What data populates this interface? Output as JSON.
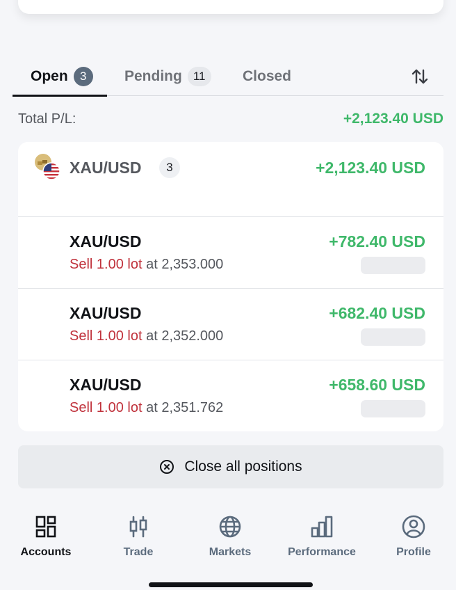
{
  "tabs": [
    {
      "label": "Open",
      "count": "3"
    },
    {
      "label": "Pending",
      "count": "11"
    },
    {
      "label": "Closed"
    }
  ],
  "summary": {
    "label": "Total P/L:",
    "value": "+2,123.40 USD"
  },
  "group": {
    "symbol": "XAU/USD",
    "count": "3",
    "pl": "+2,123.40 USD"
  },
  "positions": [
    {
      "symbol": "XAU/USD",
      "side": "Sell 1.00 lot",
      "at": "at 2,353.000",
      "pl": "+782.40 USD"
    },
    {
      "symbol": "XAU/USD",
      "side": "Sell 1.00 lot",
      "at": "at 2,352.000",
      "pl": "+682.40 USD"
    },
    {
      "symbol": "XAU/USD",
      "side": "Sell 1.00 lot",
      "at": "at 2,351.762",
      "pl": "+658.60 USD"
    }
  ],
  "close_all_label": "Close all positions",
  "nav": [
    {
      "label": "Accounts",
      "icon": "accounts-icon"
    },
    {
      "label": "Trade",
      "icon": "trade-icon"
    },
    {
      "label": "Markets",
      "icon": "globe-icon"
    },
    {
      "label": "Performance",
      "icon": "bar-chart-icon"
    },
    {
      "label": "Profile",
      "icon": "profile-icon"
    }
  ],
  "colors": {
    "profit": "#3fb86a",
    "sell": "#c0323c",
    "badge_dark": "#5b6b7d"
  }
}
